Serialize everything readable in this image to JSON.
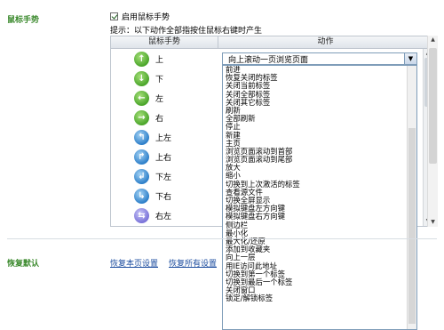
{
  "mouse_gesture": {
    "section_label": "鼠标手势",
    "enable_label": "启用鼠标手势",
    "enabled": true,
    "hint": "提示：以下动作全部指按住鼠标右键时产生",
    "columns": {
      "gesture": "鼠标手势",
      "action": "动作"
    },
    "gestures": [
      {
        "label": "上",
        "icon": "arrow-up-icon",
        "arrow": "↑",
        "color": "green"
      },
      {
        "label": "下",
        "icon": "arrow-down-icon",
        "arrow": "↓",
        "color": "green"
      },
      {
        "label": "左",
        "icon": "arrow-left-icon",
        "arrow": "←",
        "color": "green"
      },
      {
        "label": "右",
        "icon": "arrow-right-icon",
        "arrow": "→",
        "color": "green"
      },
      {
        "label": "上左",
        "icon": "arrow-up-left-icon",
        "arrow": "↰",
        "color": "blue"
      },
      {
        "label": "上右",
        "icon": "arrow-up-right-icon",
        "arrow": "↱",
        "color": "blue"
      },
      {
        "label": "下左",
        "icon": "arrow-down-left-icon",
        "arrow": "↲",
        "color": "blue"
      },
      {
        "label": "下右",
        "icon": "arrow-down-right-icon",
        "arrow": "↳",
        "color": "blue"
      },
      {
        "label": "右左",
        "icon": "arrow-right-left-icon",
        "arrow": "⇆",
        "color": "purple"
      }
    ],
    "selected_action": "向上滚动一页浏览页面",
    "action_options": [
      "前进",
      "恢复关闭的标签",
      "关闭当前标签",
      "关闭全部标签",
      "关闭其它标签",
      "刷新",
      "全部刷新",
      "停止",
      "新建",
      "主页",
      "浏览页面滚动到首部",
      "浏览页面滚动到尾部",
      "放大",
      "缩小",
      "切换到上次激活的标签",
      "查看源文件",
      "切换全屏显示",
      "模拟键盘左方向键",
      "模拟键盘右方向键",
      "侧边栏",
      "最小化",
      "最大化/还原",
      "添加到收藏夹",
      "向上一层",
      "用IE访问此地址",
      "切换到第一个标签",
      "切换到最后一个标签",
      "关闭窗口",
      "锁定/解锁标签"
    ]
  },
  "reset": {
    "section_label": "恢复默认",
    "reset_page_label": "恢复本页设置",
    "reset_all_label": "恢复所有设置"
  }
}
